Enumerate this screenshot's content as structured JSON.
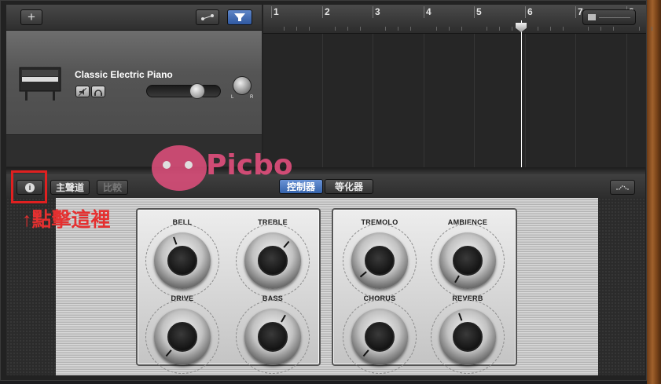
{
  "header": {
    "add_icon": "+",
    "btn1_icon": "automation-icon",
    "btn2_icon": "filter-icon"
  },
  "track": {
    "name": "Classic Electric Piano",
    "mute_icon": "mute-icon",
    "headphone_icon": "headphone-icon",
    "pan_l": "L",
    "pan_r": "R",
    "volume_level": 0.75
  },
  "ruler": {
    "bars": [
      "1",
      "2",
      "3",
      "4",
      "5",
      "6",
      "7",
      "8"
    ]
  },
  "editor": {
    "info_icon": "i",
    "master_label": "主聲道",
    "compare_label": "比較",
    "controls_label": "控制器",
    "eq_label": "等化器"
  },
  "annotation": {
    "text": "↑點擊這裡"
  },
  "watermark": {
    "text": "Picbo"
  },
  "knobs": {
    "bell": {
      "label": "BELL"
    },
    "treble": {
      "label": "TREBLE"
    },
    "drive": {
      "label": "DRIVE"
    },
    "bass": {
      "label": "BASS"
    },
    "tremolo": {
      "label": "TREMOLO"
    },
    "ambience": {
      "label": "AMBIENCE"
    },
    "chorus": {
      "label": "CHORUS"
    },
    "reverb": {
      "label": "REVERB"
    }
  }
}
